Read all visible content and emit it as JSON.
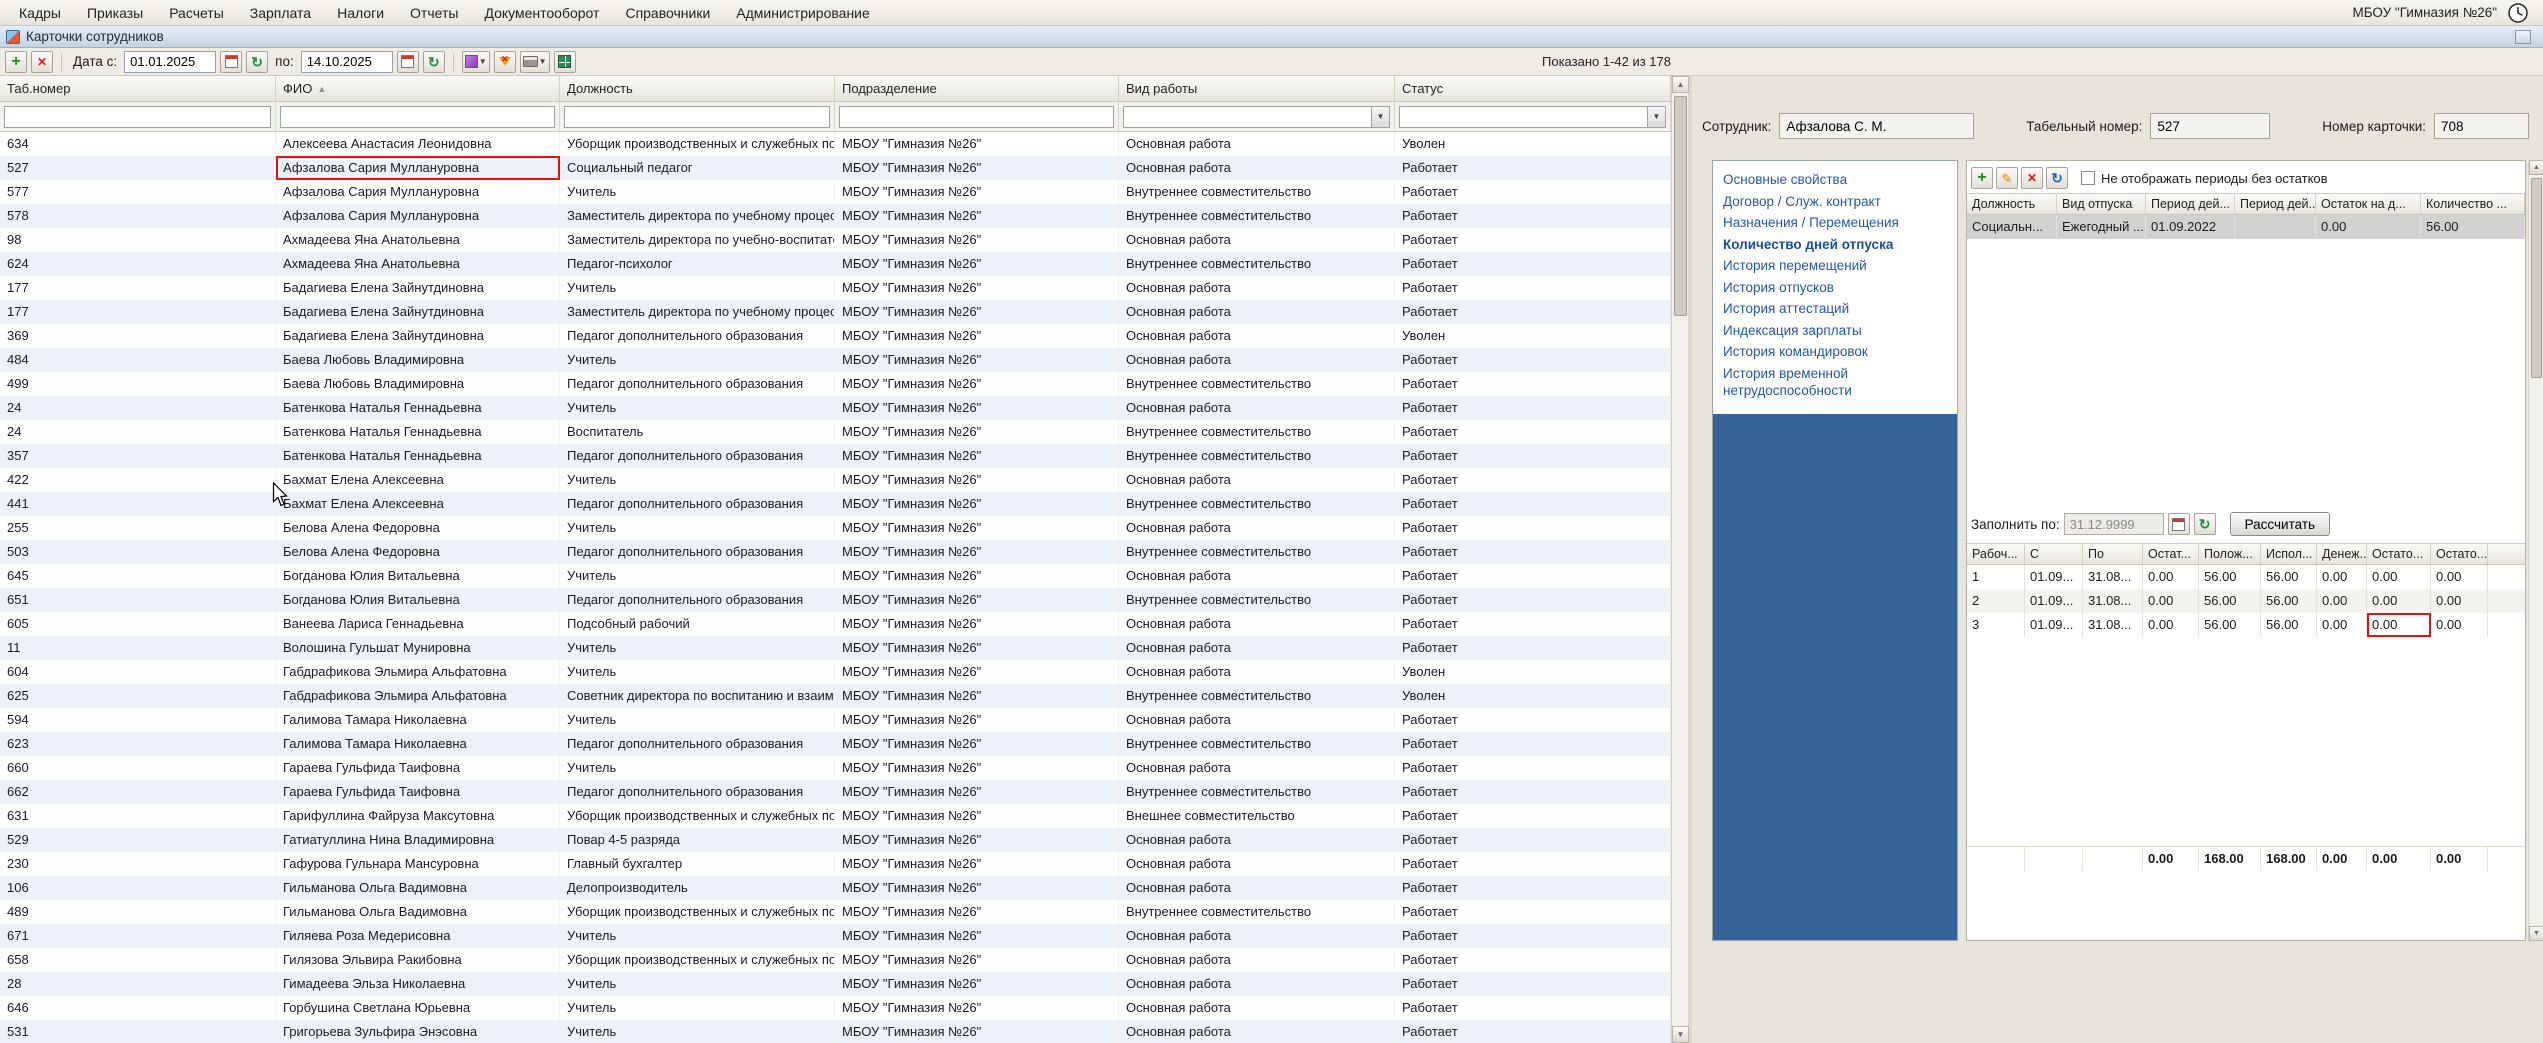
{
  "menu": {
    "items": [
      "Кадры",
      "Приказы",
      "Расчеты",
      "Зарплата",
      "Налоги",
      "Отчеты",
      "Документооборот",
      "Справочники",
      "Администрирование"
    ],
    "org": "МБОУ \"Гимназия №26\""
  },
  "titlebar": {
    "title": "Карточки сотрудников"
  },
  "toolbar": {
    "date_from_label": "Дата с:",
    "date_from": "01.01.2025",
    "date_to_label": "по:",
    "date_to": "14.10.2025",
    "results_info": "Показано 1-42 из 178"
  },
  "employee_table": {
    "columns": [
      "Таб.номер",
      "ФИО",
      "Должность",
      "Подразделение",
      "Вид работы",
      "Статус"
    ],
    "sort_icon": "▲",
    "selected_index": 1,
    "rows": [
      [
        "634",
        "Алексеева Анастасия Леонидовна",
        "Уборщик производственных и служебных по...",
        "МБОУ \"Гимназия №26\"",
        "Основная работа",
        "Уволен"
      ],
      [
        "527",
        "Афзалова Сария Муллануровна",
        "Социальный педагог",
        "МБОУ \"Гимназия №26\"",
        "Основная работа",
        "Работает"
      ],
      [
        "577",
        "Афзалова Сария Муллануровна",
        "Учитель",
        "МБОУ \"Гимназия №26\"",
        "Внутреннее совместительство",
        "Работает"
      ],
      [
        "578",
        "Афзалова Сария Муллануровна",
        "Заместитель директора по учебному процессу",
        "МБОУ \"Гимназия №26\"",
        "Внутреннее совместительство",
        "Работает"
      ],
      [
        "98",
        "Ахмадеева Яна Анатольевна",
        "Заместитель директора по учебно-воспитате...",
        "МБОУ \"Гимназия №26\"",
        "Основная работа",
        "Работает"
      ],
      [
        "624",
        "Ахмадеева Яна Анатольевна",
        "Педагог-психолог",
        "МБОУ \"Гимназия №26\"",
        "Внутреннее совместительство",
        "Работает"
      ],
      [
        "177",
        "Бадагиева Елена Зайнутдиновна",
        "Учитель",
        "МБОУ \"Гимназия №26\"",
        "Основная работа",
        "Работает"
      ],
      [
        "177",
        "Бадагиева Елена Зайнутдиновна",
        "Заместитель директора по учебному процессу",
        "МБОУ \"Гимназия №26\"",
        "Основная работа",
        "Работает"
      ],
      [
        "369",
        "Бадагиева Елена Зайнутдиновна",
        "Педагог дополнительного образования",
        "МБОУ \"Гимназия №26\"",
        "Основная работа",
        "Уволен"
      ],
      [
        "484",
        "Баева Любовь Владимировна",
        "Учитель",
        "МБОУ \"Гимназия №26\"",
        "Основная работа",
        "Работает"
      ],
      [
        "499",
        "Баева Любовь Владимировна",
        "Педагог дополнительного образования",
        "МБОУ \"Гимназия №26\"",
        "Внутреннее совместительство",
        "Работает"
      ],
      [
        "24",
        "Батенкова Наталья Геннадьевна",
        "Учитель",
        "МБОУ \"Гимназия №26\"",
        "Основная работа",
        "Работает"
      ],
      [
        "24",
        "Батенкова Наталья Геннадьевна",
        "Воспитатель",
        "МБОУ \"Гимназия №26\"",
        "Внутреннее совместительство",
        "Работает"
      ],
      [
        "357",
        "Батенкова Наталья Геннадьевна",
        "Педагог дополнительного образования",
        "МБОУ \"Гимназия №26\"",
        "Внутреннее совместительство",
        "Работает"
      ],
      [
        "422",
        "Бахмат Елена Алексеевна",
        "Учитель",
        "МБОУ \"Гимназия №26\"",
        "Основная работа",
        "Работает"
      ],
      [
        "441",
        "Бахмат Елена Алексеевна",
        "Педагог дополнительного образования",
        "МБОУ \"Гимназия №26\"",
        "Внутреннее совместительство",
        "Работает"
      ],
      [
        "255",
        "Белова Алена Федоровна",
        "Учитель",
        "МБОУ \"Гимназия №26\"",
        "Основная работа",
        "Работает"
      ],
      [
        "503",
        "Белова Алена Федоровна",
        "Педагог дополнительного образования",
        "МБОУ \"Гимназия №26\"",
        "Внутреннее совместительство",
        "Работает"
      ],
      [
        "645",
        "Богданова Юлия Витальевна",
        "Учитель",
        "МБОУ \"Гимназия №26\"",
        "Основная работа",
        "Работает"
      ],
      [
        "651",
        "Богданова Юлия Витальевна",
        "Педагог дополнительного образования",
        "МБОУ \"Гимназия №26\"",
        "Внутреннее совместительство",
        "Работает"
      ],
      [
        "605",
        "Ванеева Лариса Геннадьевна",
        "Подсобный рабочий",
        "МБОУ \"Гимназия №26\"",
        "Основная работа",
        "Работает"
      ],
      [
        "11",
        "Волошина Гульшат Мунировна",
        "Учитель",
        "МБОУ \"Гимназия №26\"",
        "Основная работа",
        "Работает"
      ],
      [
        "604",
        "Габдрафикова Эльмира Альфатовна",
        "Учитель",
        "МБОУ \"Гимназия №26\"",
        "Основная работа",
        "Уволен"
      ],
      [
        "625",
        "Габдрафикова Эльмира Альфатовна",
        "Советник директора по воспитанию и взаим...",
        "МБОУ \"Гимназия №26\"",
        "Внутреннее совместительство",
        "Уволен"
      ],
      [
        "594",
        "Галимова Тамара Николаевна",
        "Учитель",
        "МБОУ \"Гимназия №26\"",
        "Основная работа",
        "Работает"
      ],
      [
        "623",
        "Галимова Тамара Николаевна",
        "Педагог дополнительного образования",
        "МБОУ \"Гимназия №26\"",
        "Внутреннее совместительство",
        "Работает"
      ],
      [
        "660",
        "Гараева Гульфида Таифовна",
        "Учитель",
        "МБОУ \"Гимназия №26\"",
        "Основная работа",
        "Работает"
      ],
      [
        "662",
        "Гараева Гульфида Таифовна",
        "Педагог дополнительного образования",
        "МБОУ \"Гимназия №26\"",
        "Внутреннее совместительство",
        "Работает"
      ],
      [
        "631",
        "Гарифуллина Файруза Максутовна",
        "Уборщик производственных и служебных по...",
        "МБОУ \"Гимназия №26\"",
        "Внешнее совместительство",
        "Работает"
      ],
      [
        "529",
        "Гатиатуллина Нина Владимировна",
        "Повар 4-5 разряда",
        "МБОУ \"Гимназия №26\"",
        "Основная работа",
        "Работает"
      ],
      [
        "230",
        "Гафурова Гульнара Мансуровна",
        "Главный бухгалтер",
        "МБОУ \"Гимназия №26\"",
        "Основная работа",
        "Работает"
      ],
      [
        "106",
        "Гильманова Ольга Вадимовна",
        "Делопроизводитель",
        "МБОУ \"Гимназия №26\"",
        "Основная работа",
        "Работает"
      ],
      [
        "489",
        "Гильманова Ольга Вадимовна",
        "Уборщик производственных и служебных по...",
        "МБОУ \"Гимназия №26\"",
        "Внутреннее совместительство",
        "Работает"
      ],
      [
        "671",
        "Гиляева Роза Медерисовна",
        "Учитель",
        "МБОУ \"Гимназия №26\"",
        "Основная работа",
        "Работает"
      ],
      [
        "658",
        "Гилязова Эльвира Ракибовна",
        "Уборщик производственных и служебных по...",
        "МБОУ \"Гимназия №26\"",
        "Основная работа",
        "Работает"
      ],
      [
        "28",
        "Гимадеева Эльза Николаевна",
        "Учитель",
        "МБОУ \"Гимназия №26\"",
        "Основная работа",
        "Работает"
      ],
      [
        "646",
        "Горбушина Светлана Юрьевна",
        "Учитель",
        "МБОУ \"Гимназия №26\"",
        "Основная работа",
        "Работает"
      ],
      [
        "531",
        "Григорьева Зульфира Энэсовна",
        "Учитель",
        "МБОУ \"Гимназия №26\"",
        "Основная работа",
        "Работает"
      ]
    ]
  },
  "detail": {
    "employee_label": "Сотрудник:",
    "employee_value": "Афзалова С. М.",
    "tab_number_label": "Табельный номер:",
    "tab_number_value": "527",
    "card_number_label": "Номер карточки:",
    "card_number_value": "708",
    "nav_items": [
      "Основные свойства",
      "Договор / Служ. контракт",
      "Назначения / Перемещения",
      "Количество дней отпуска",
      "История перемещений",
      "История отпусков",
      "История аттестаций",
      "Индексация зарплаты",
      "История командировок",
      "История временной нетрудоспособности"
    ],
    "active_nav_index": 3,
    "hide_empty_label": "Не отображать периоды без остатков",
    "vacation_table": {
      "columns": [
        "Должность",
        "Вид отпуска",
        "Период дей...",
        "Период дей...",
        "Остаток на д...",
        "Количество ..."
      ],
      "rows": [
        [
          "Социальн...",
          "Ежегодный ...",
          "01.09.2022",
          "",
          "0.00",
          "56.00"
        ]
      ]
    },
    "fill_by_label": "Заполнить по:",
    "fill_by_value": "31.12.9999",
    "calc_button": "Рассчитать",
    "periods_table": {
      "columns": [
        "Рабоч...",
        "С",
        "По",
        "Остат...",
        "Полож...",
        "Испол...",
        "Денеж...",
        "Остато...",
        "Остато..."
      ],
      "rows": [
        [
          "1",
          "01.09...",
          "31.08...",
          "0.00",
          "56.00",
          "56.00",
          "0.00",
          "0.00",
          "0.00"
        ],
        [
          "2",
          "01.09...",
          "31.08...",
          "0.00",
          "56.00",
          "56.00",
          "0.00",
          "0.00",
          "0.00"
        ],
        [
          "3",
          "01.09...",
          "31.08...",
          "0.00",
          "56.00",
          "56.00",
          "0.00",
          "0.00",
          "0.00"
        ]
      ],
      "totals": [
        "",
        "",
        "",
        "0.00",
        "168.00",
        "168.00",
        "0.00",
        "0.00",
        "0.00"
      ]
    }
  },
  "annotations": {
    "employee_box": {
      "row": 1,
      "col": 1
    },
    "periods_box": {
      "row": 2,
      "col": 7
    }
  },
  "colors": {
    "accent_blue": "#376297",
    "selection_gray": "#d2d2d2",
    "annotation_red": "#e01212"
  }
}
